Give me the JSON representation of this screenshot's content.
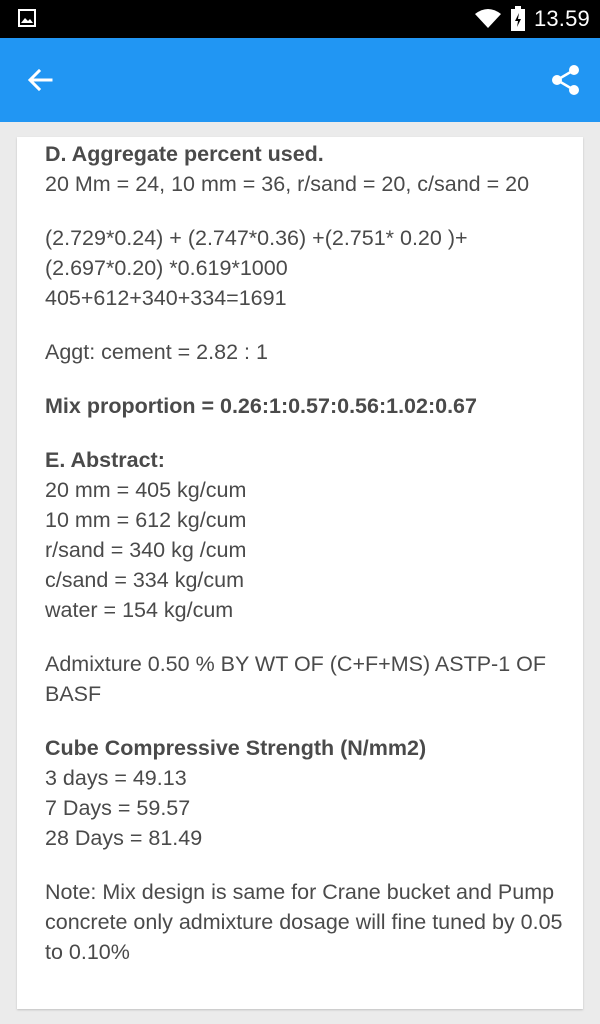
{
  "status_bar": {
    "time": "13.59",
    "icons": [
      "image-icon",
      "wifi-icon",
      "battery-icon"
    ]
  },
  "app_bar": {
    "color": "#2196f3",
    "back_icon": "arrow-back-icon",
    "share_icon": "share-icon"
  },
  "content": {
    "aggregate": {
      "heading": "D. Aggregate percent used.",
      "ratio_line": "20 Mm = 24, 10 mm = 36, r/sand = 20, c/sand = 20"
    },
    "calculation": {
      "line1": "(2.729*0.24) + (2.747*0.36) +(2.751* 0.20 )+",
      "line2": "(2.697*0.20) *0.619*1000",
      "line3": "405+612+340+334=1691"
    },
    "aggt_cement": "Aggt: cement = 2.82 : 1",
    "mix_proportion": "Mix proportion = 0.26:1:0.57:0.56:1.02:0.67",
    "abstract": {
      "heading": "E. Abstract:",
      "items": [
        "20 mm = 405 kg/cum",
        "10 mm = 612 kg/cum",
        "r/sand = 340 kg /cum",
        "c/sand = 334 kg/cum",
        "water = 154 kg/cum"
      ]
    },
    "admixture": "Admixture 0.50 % BY WT OF (C+F+MS) ASTP-1 OF BASF",
    "strength": {
      "heading": "Cube Compressive Strength (N/mm2)",
      "items": [
        "3 days = 49.13",
        "7 Days = 59.57",
        "28 Days = 81.49"
      ]
    },
    "note": "Note: Mix design is same for Crane bucket and Pump concrete only admixture dosage will fine tuned by 0.05 to 0.10%"
  }
}
